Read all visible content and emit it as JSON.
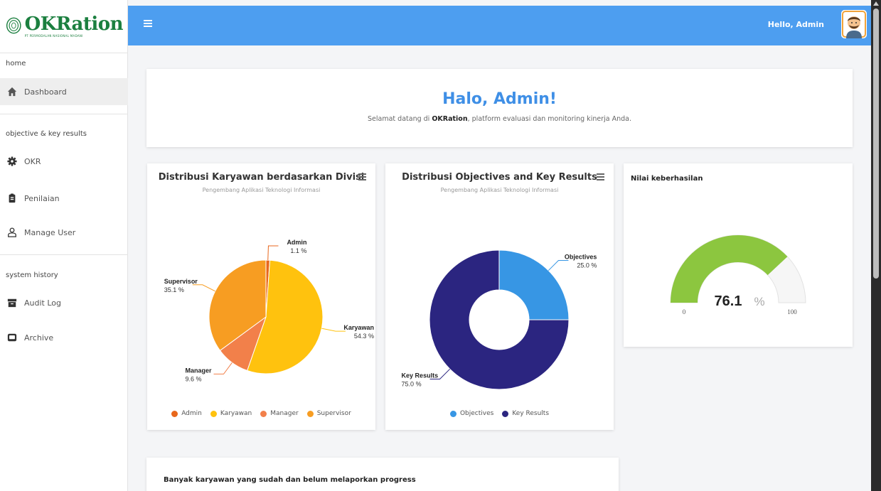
{
  "app": {
    "logo_title": "OKRation",
    "logo_sub": "PT PERMODALAN NASIONAL MADANI",
    "greeting": "Hello, Admin"
  },
  "sidebar": {
    "sections": [
      {
        "label": "home",
        "items": [
          {
            "label": "Dashboard",
            "icon": "home-icon",
            "active": true
          }
        ]
      },
      {
        "label": "objective & key results",
        "items": [
          {
            "label": "OKR",
            "icon": "gear-icon"
          },
          {
            "label": "Penilaian",
            "icon": "clipboard-icon"
          },
          {
            "label": "Manage User",
            "icon": "user-icon"
          }
        ]
      },
      {
        "label": "system history",
        "items": [
          {
            "label": "Audit Log",
            "icon": "archive-box-icon"
          },
          {
            "label": "Archive",
            "icon": "message-icon"
          }
        ]
      }
    ]
  },
  "welcome": {
    "title": "Halo, Admin!",
    "text_before": "Selamat datang di ",
    "text_bold": "OKRation",
    "text_after": ", platform evaluasi dan monitoring kinerja Anda."
  },
  "chart_data": [
    {
      "type": "pie",
      "title": "Distribusi Karyawan berdasarkan Divisi",
      "subtitle": "Pengembang Aplikasi Teknologi Informasi",
      "categories": [
        "Admin",
        "Karyawan",
        "Manager",
        "Supervisor"
      ],
      "values": [
        1.1,
        54.3,
        9.6,
        35.1
      ],
      "labels": [
        "1.1 %",
        "54.3 %",
        "9.6 %",
        "35.1 %"
      ],
      "colors": [
        "#e8671c",
        "#ffc20e",
        "#f2804a",
        "#f79d22"
      ],
      "legend": "bottom"
    },
    {
      "type": "pie",
      "donut": true,
      "title": "Distribusi Objectives and Key Results",
      "subtitle": "Pengembang Aplikasi Teknologi Informasi",
      "categories": [
        "Objectives",
        "Key Results"
      ],
      "values": [
        25.0,
        75.0
      ],
      "labels": [
        "25.0 %",
        "75.0 %"
      ],
      "colors": [
        "#3796e4",
        "#2b2580"
      ],
      "legend": "bottom"
    }
  ],
  "gauge": {
    "title": "Nilai keberhasilan",
    "value": 76.1,
    "value_text": "76.1",
    "unit": "%",
    "min": 0,
    "max": 100,
    "min_label": "0",
    "max_label": "100",
    "color": "#8cc63f"
  },
  "bottom_card": {
    "title": "Banyak karyawan yang sudah dan belum melaporkan progress"
  },
  "colors": {
    "topbar": "#4d9ef0",
    "brand": "#1b7f3f",
    "accent": "#3f8fe6"
  }
}
